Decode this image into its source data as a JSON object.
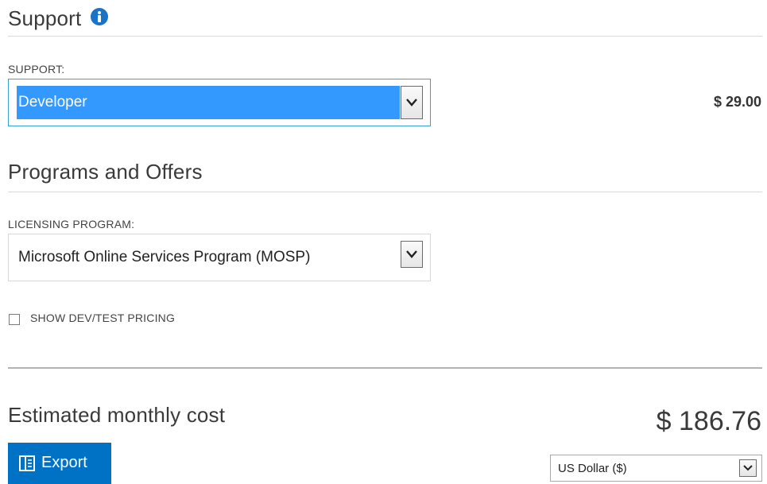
{
  "support": {
    "title": "Support",
    "label": "SUPPORT:",
    "selected": "Developer",
    "price": "$ 29.00"
  },
  "programs": {
    "title": "Programs and Offers",
    "label": "LICENSING PROGRAM:",
    "selected": "Microsoft Online Services Program (MOSP)",
    "dev_test_label": "SHOW DEV/TEST PRICING",
    "dev_test_checked": false
  },
  "summary": {
    "title": "Estimated monthly cost",
    "total": "$ 186.76",
    "export_label": "Export",
    "currency": "US Dollar ($)"
  },
  "colors": {
    "accent": "#0072c6",
    "info_icon": "#1a73c6",
    "selection_highlight": "#3399ff",
    "focus_border": "#3aa0d8"
  },
  "icons": {
    "info": "info-icon",
    "export": "export-icon",
    "dropdown": "chevron-down-icon"
  }
}
